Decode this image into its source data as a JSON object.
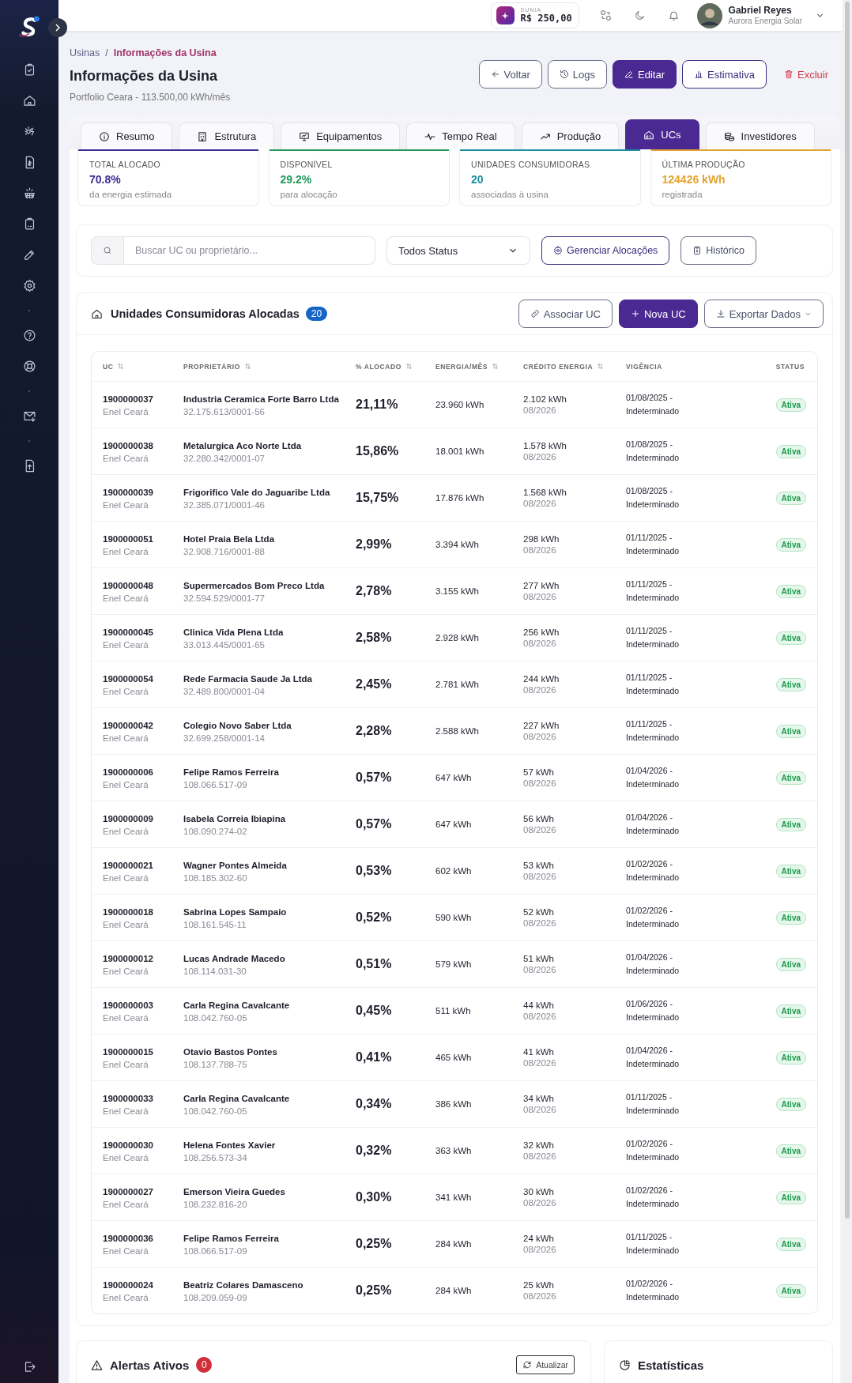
{
  "header": {
    "wallet": {
      "label": "SUNIA",
      "amount": "R$ 250,00"
    },
    "user": {
      "name": "Gabriel Reyes",
      "company": "Aurora Energia Solar"
    }
  },
  "breadcrumb": {
    "separator": "/",
    "items": [
      {
        "label": "Usinas",
        "current": false
      },
      {
        "label": "Informações da Usina",
        "current": true
      }
    ]
  },
  "page": {
    "title": "Informações da Usina",
    "subtitle": "Portfolio Ceara - 113.500,00 kWh/mês"
  },
  "actions": [
    {
      "label": "Voltar",
      "kind": "outline"
    },
    {
      "label": "Logs",
      "kind": "outline"
    },
    {
      "label": "Editar",
      "kind": "primary"
    },
    {
      "label": "Estimativa",
      "kind": "accent"
    },
    {
      "label": "Excluir",
      "kind": "danger"
    }
  ],
  "tabs": [
    {
      "label": "Resumo",
      "selected": false
    },
    {
      "label": "Estrutura",
      "selected": false
    },
    {
      "label": "Equipamentos",
      "selected": false
    },
    {
      "label": "Tempo Real",
      "selected": false
    },
    {
      "label": "Produção",
      "selected": false
    },
    {
      "label": "UCs",
      "selected": true
    },
    {
      "label": "Investidores",
      "selected": false
    }
  ],
  "stats": [
    {
      "title": "TOTAL ALOCADO",
      "value": "70.8%",
      "note": "da energia estimada",
      "color": "#3b2a8f"
    },
    {
      "title": "DISPONÍVEL",
      "value": "29.2%",
      "note": "para alocação",
      "color": "#1f9a5c"
    },
    {
      "title": "UNIDADES CONSUMIDORAS",
      "value": "20",
      "note": "associadas à usina",
      "color": "#1b8fa0"
    },
    {
      "title": "ÚLTIMA PRODUÇÃO",
      "value": "124426 kWh",
      "note": "registrada",
      "color": "#e3a32c"
    }
  ],
  "filters": {
    "search_placeholder": "Buscar UC ou proprietário...",
    "status_select": "Todos Status",
    "buttons": [
      "Gerenciar Alocações",
      "Histórico"
    ]
  },
  "ucs": {
    "title": "Unidades Consumidoras Alocadas",
    "count": "20",
    "buttons": [
      {
        "label": "Associar UC",
        "kind": "outline"
      },
      {
        "label": "Nova UC",
        "kind": "primary"
      },
      {
        "label": "Exportar Dados",
        "kind": "menu"
      }
    ],
    "columns": [
      {
        "label": "UC",
        "sortable": true
      },
      {
        "label": "PROPRIETÁRIO",
        "sortable": true
      },
      {
        "label": "% ALOCADO",
        "sortable": true
      },
      {
        "label": "ENERGIA/MÊS",
        "sortable": true
      },
      {
        "label": "CRÉDITO ENERGIA",
        "sortable": true
      },
      {
        "label": "VIGÊNCIA",
        "sortable": false
      },
      {
        "label": "STATUS",
        "sortable": false
      }
    ],
    "rows": [
      {
        "uc": "1900000037",
        "utility": "Enel Ceará",
        "owner": "Industria Ceramica Forte Barro Ltda",
        "document": "32.175.613/0001-56",
        "allocated": "21,11%",
        "energy": "23.960 kWh",
        "credit": "2.102 kWh",
        "credit_period": "08/2026",
        "validity": "01/08/2025 - Indeterminado",
        "status": "Ativa"
      },
      {
        "uc": "1900000038",
        "utility": "Enel Ceará",
        "owner": "Metalurgica Aco Norte Ltda",
        "document": "32.280.342/0001-07",
        "allocated": "15,86%",
        "energy": "18.001 kWh",
        "credit": "1.578 kWh",
        "credit_period": "08/2026",
        "validity": "01/08/2025 - Indeterminado",
        "status": "Ativa"
      },
      {
        "uc": "1900000039",
        "utility": "Enel Ceará",
        "owner": "Frigorifico Vale do Jaguaribe Ltda",
        "document": "32.385.071/0001-46",
        "allocated": "15,75%",
        "energy": "17.876 kWh",
        "credit": "1.568 kWh",
        "credit_period": "08/2026",
        "validity": "01/08/2025 - Indeterminado",
        "status": "Ativa"
      },
      {
        "uc": "1900000051",
        "utility": "Enel Ceará",
        "owner": "Hotel Praia Bela Ltda",
        "document": "32.908.716/0001-88",
        "allocated": "2,99%",
        "energy": "3.394 kWh",
        "credit": "298 kWh",
        "credit_period": "08/2026",
        "validity": "01/11/2025 - Indeterminado",
        "status": "Ativa"
      },
      {
        "uc": "1900000048",
        "utility": "Enel Ceará",
        "owner": "Supermercados Bom Preco Ltda",
        "document": "32.594.529/0001-77",
        "allocated": "2,78%",
        "energy": "3.155 kWh",
        "credit": "277 kWh",
        "credit_period": "08/2026",
        "validity": "01/11/2025 - Indeterminado",
        "status": "Ativa"
      },
      {
        "uc": "1900000045",
        "utility": "Enel Ceará",
        "owner": "Clinica Vida Plena Ltda",
        "document": "33.013.445/0001-65",
        "allocated": "2,58%",
        "energy": "2.928 kWh",
        "credit": "256 kWh",
        "credit_period": "08/2026",
        "validity": "01/11/2025 - Indeterminado",
        "status": "Ativa"
      },
      {
        "uc": "1900000054",
        "utility": "Enel Ceará",
        "owner": "Rede Farmacia Saude Ja Ltda",
        "document": "32.489.800/0001-04",
        "allocated": "2,45%",
        "energy": "2.781 kWh",
        "credit": "244 kWh",
        "credit_period": "08/2026",
        "validity": "01/11/2025 - Indeterminado",
        "status": "Ativa"
      },
      {
        "uc": "1900000042",
        "utility": "Enel Ceará",
        "owner": "Colegio Novo Saber Ltda",
        "document": "32.699.258/0001-14",
        "allocated": "2,28%",
        "energy": "2.588 kWh",
        "credit": "227 kWh",
        "credit_period": "08/2026",
        "validity": "01/11/2025 - Indeterminado",
        "status": "Ativa"
      },
      {
        "uc": "1900000006",
        "utility": "Enel Ceará",
        "owner": "Felipe Ramos Ferreira",
        "document": "108.066.517-09",
        "allocated": "0,57%",
        "energy": "647 kWh",
        "credit": "57 kWh",
        "credit_period": "08/2026",
        "validity": "01/04/2026 - Indeterminado",
        "status": "Ativa"
      },
      {
        "uc": "1900000009",
        "utility": "Enel Ceará",
        "owner": "Isabela Correia Ibiapina",
        "document": "108.090.274-02",
        "allocated": "0,57%",
        "energy": "647 kWh",
        "credit": "56 kWh",
        "credit_period": "08/2026",
        "validity": "01/04/2026 - Indeterminado",
        "status": "Ativa"
      },
      {
        "uc": "1900000021",
        "utility": "Enel Ceará",
        "owner": "Wagner Pontes Almeida",
        "document": "108.185.302-60",
        "allocated": "0,53%",
        "energy": "602 kWh",
        "credit": "53 kWh",
        "credit_period": "08/2026",
        "validity": "01/02/2026 - Indeterminado",
        "status": "Ativa"
      },
      {
        "uc": "1900000018",
        "utility": "Enel Ceará",
        "owner": "Sabrina Lopes Sampaio",
        "document": "108.161.545-11",
        "allocated": "0,52%",
        "energy": "590 kWh",
        "credit": "52 kWh",
        "credit_period": "08/2026",
        "validity": "01/02/2026 - Indeterminado",
        "status": "Ativa"
      },
      {
        "uc": "1900000012",
        "utility": "Enel Ceará",
        "owner": "Lucas Andrade Macedo",
        "document": "108.114.031-30",
        "allocated": "0,51%",
        "energy": "579 kWh",
        "credit": "51 kWh",
        "credit_period": "08/2026",
        "validity": "01/04/2026 - Indeterminado",
        "status": "Ativa"
      },
      {
        "uc": "1900000003",
        "utility": "Enel Ceará",
        "owner": "Carla Regina Cavalcante",
        "document": "108.042.760-05",
        "allocated": "0,45%",
        "energy": "511 kWh",
        "credit": "44 kWh",
        "credit_period": "08/2026",
        "validity": "01/06/2026 - Indeterminado",
        "status": "Ativa"
      },
      {
        "uc": "1900000015",
        "utility": "Enel Ceará",
        "owner": "Otavio Bastos Pontes",
        "document": "108.137.788-75",
        "allocated": "0,41%",
        "energy": "465 kWh",
        "credit": "41 kWh",
        "credit_period": "08/2026",
        "validity": "01/04/2026 - Indeterminado",
        "status": "Ativa"
      },
      {
        "uc": "1900000033",
        "utility": "Enel Ceará",
        "owner": "Carla Regina Cavalcante",
        "document": "108.042.760-05",
        "allocated": "0,34%",
        "energy": "386 kWh",
        "credit": "34 kWh",
        "credit_period": "08/2026",
        "validity": "01/11/2025 - Indeterminado",
        "status": "Ativa"
      },
      {
        "uc": "1900000030",
        "utility": "Enel Ceará",
        "owner": "Helena Fontes Xavier",
        "document": "108.256.573-34",
        "allocated": "0,32%",
        "energy": "363 kWh",
        "credit": "32 kWh",
        "credit_period": "08/2026",
        "validity": "01/02/2026 - Indeterminado",
        "status": "Ativa"
      },
      {
        "uc": "1900000027",
        "utility": "Enel Ceará",
        "owner": "Emerson Vieira Guedes",
        "document": "108.232.816-20",
        "allocated": "0,30%",
        "energy": "341 kWh",
        "credit": "30 kWh",
        "credit_period": "08/2026",
        "validity": "01/02/2026 - Indeterminado",
        "status": "Ativa"
      },
      {
        "uc": "1900000036",
        "utility": "Enel Ceará",
        "owner": "Felipe Ramos Ferreira",
        "document": "108.066.517-09",
        "allocated": "0,25%",
        "energy": "284 kWh",
        "credit": "24 kWh",
        "credit_period": "08/2026",
        "validity": "01/11/2025 - Indeterminado",
        "status": "Ativa"
      },
      {
        "uc": "1900000024",
        "utility": "Enel Ceará",
        "owner": "Beatriz Colares Damasceno",
        "document": "108.209.059-09",
        "allocated": "0,25%",
        "energy": "284 kWh",
        "credit": "25 kWh",
        "credit_period": "08/2026",
        "validity": "01/02/2026 - Indeterminado",
        "status": "Ativa"
      }
    ]
  },
  "alerts": {
    "title": "Alertas Ativos",
    "count": "0",
    "button": "Atualizar"
  },
  "statistics": {
    "title": "Estatísticas"
  }
}
